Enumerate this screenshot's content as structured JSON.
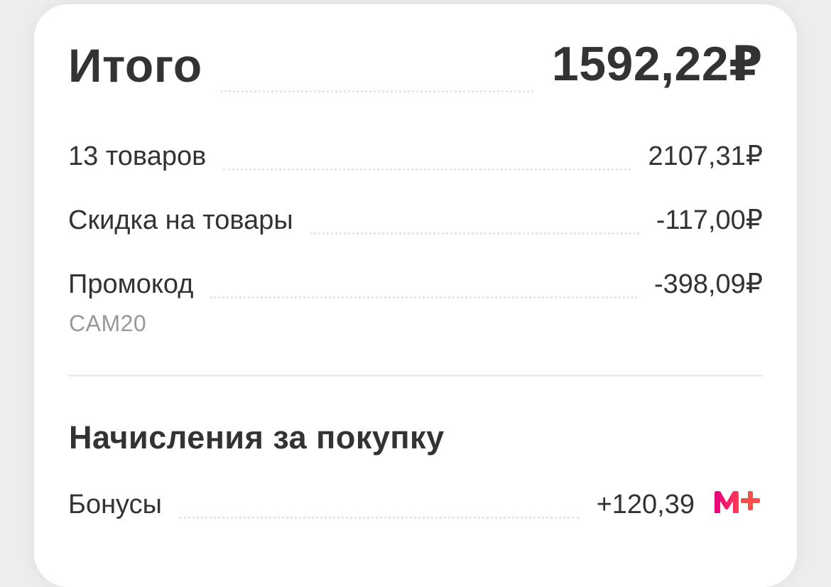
{
  "summary": {
    "total_label": "Итого",
    "total_value": "1592,22₽",
    "items": [
      {
        "label": "13 товаров",
        "value": "2107,31₽"
      },
      {
        "label": "Скидка на товары",
        "value": "-117,00₽"
      },
      {
        "label": "Промокод",
        "value": "-398,09₽",
        "sublabel": "CAM20"
      }
    ]
  },
  "rewards": {
    "title": "Начисления за покупку",
    "bonus_label": "Бонусы",
    "bonus_value": "+120,39",
    "bonus_icon": "mplus-logo-icon"
  },
  "colors": {
    "text": "#333333",
    "muted": "#999999",
    "brand": "#e6007e",
    "brand_accent": "#ff4c4c"
  }
}
